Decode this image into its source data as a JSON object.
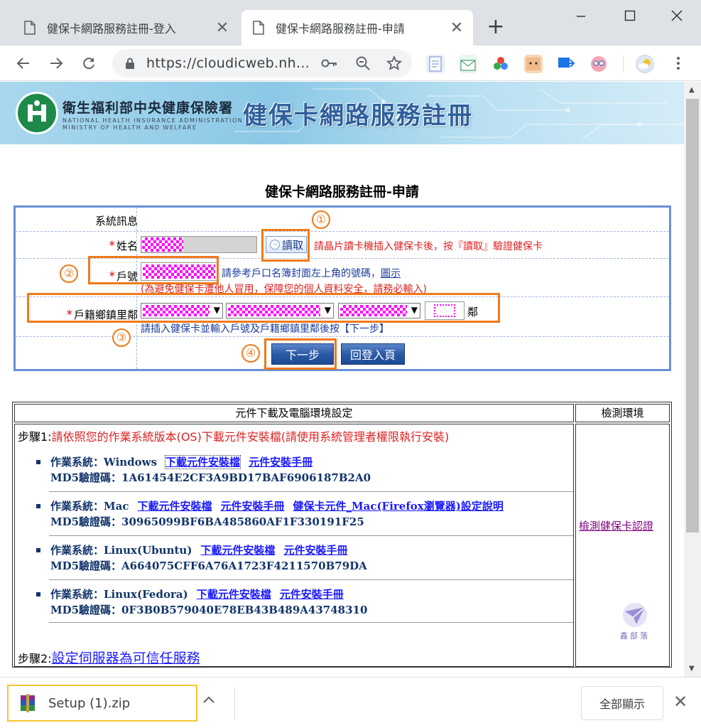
{
  "browser": {
    "tabs": [
      {
        "title": "健保卡網路服務註冊-登入",
        "active": false
      },
      {
        "title": "健保卡網路服務註冊-申請",
        "active": true
      }
    ],
    "url": "https://cloudicweb.nh..."
  },
  "banner": {
    "agency_name": "衛生福利部中央健康保險署",
    "agency_en_line1": "NATIONAL HEALTH INSURANCE ADMINISTRATION",
    "agency_en_line2": "MINISTRY OF HEALTH AND WELFARE",
    "title": "健保卡網路服務註冊"
  },
  "page": {
    "title": "健保卡網路服務註冊-申請"
  },
  "form": {
    "system_message_label": "系統訊息",
    "required_mark": "*",
    "name_label": "姓名",
    "read_button": "讀取",
    "read_hint": "請晶片讀卡機插入健保卡後，按『讀取』驗證健保卡",
    "household_label": "戶號",
    "household_hint": "請參考戶口名簿封面左上角的號碼，",
    "household_hint_link": "圖示",
    "household_warning": "(為避免健保卡遭他人冒用，保障您的個人資料安全，請務必輸入)",
    "address_label": "戶籍鄉鎮里鄰",
    "neighborhood_suffix": "鄰",
    "address_hint": "請插入健保卡並輸入戶號及戶籍鄉鎮里鄰後按【下一步】",
    "next_button": "下一步",
    "back_button": "回登入頁",
    "annotations": [
      "①",
      "②",
      "③",
      "④"
    ]
  },
  "downloads": {
    "header_left": "元件下載及電腦環境設定",
    "header_right": "檢測環境",
    "step1_prefix": "步驟1:",
    "step1_text": "請依照您的作業系統版本(OS)下載元件安裝檔(請使用系統管理者權限執行安裝)",
    "os_list": [
      {
        "os": "作業系統：Windows",
        "links": [
          "下載元件安裝檔",
          "元件安裝手冊"
        ],
        "md5": "MD5驗證碼：1A61454E2CF3A9BD17BAF6906187B2A0"
      },
      {
        "os": "作業系統：Mac",
        "links": [
          "下載元件安裝檔",
          "元件安裝手冊",
          "健保卡元件_Mac(Firefox瀏覽器)設定說明"
        ],
        "md5": "MD5驗證碼：30965099BF6BA485860AF1F330191F25"
      },
      {
        "os": "作業系統：Linux(Ubuntu)",
        "links": [
          "下載元件安裝檔",
          "元件安裝手冊"
        ],
        "md5": "MD5驗證碼：A664075CFF6A76A1723F4211570B79DA"
      },
      {
        "os": "作業系統：Linux(Fedora)",
        "links": [
          "下載元件安裝檔",
          "元件安裝手冊"
        ],
        "md5": "MD5驗證碼：0F3B0B579040E78EB43B489A43748310"
      }
    ],
    "step2_prefix": "步驟2:",
    "step2_link": "設定伺服器為可信任服務",
    "check_link": "檢測健保卡認證",
    "watermark": "鑫部落"
  },
  "shelf": {
    "file_name": "Setup (1).zip",
    "show_all": "全部顯示"
  },
  "colors": {
    "annotation_orange": "#f07a1a",
    "form_border": "#6a8fd8",
    "button_blue": "#2b5aa6",
    "redacted_magenta": "#ff00ff",
    "download_highlight": "#f5c431"
  }
}
